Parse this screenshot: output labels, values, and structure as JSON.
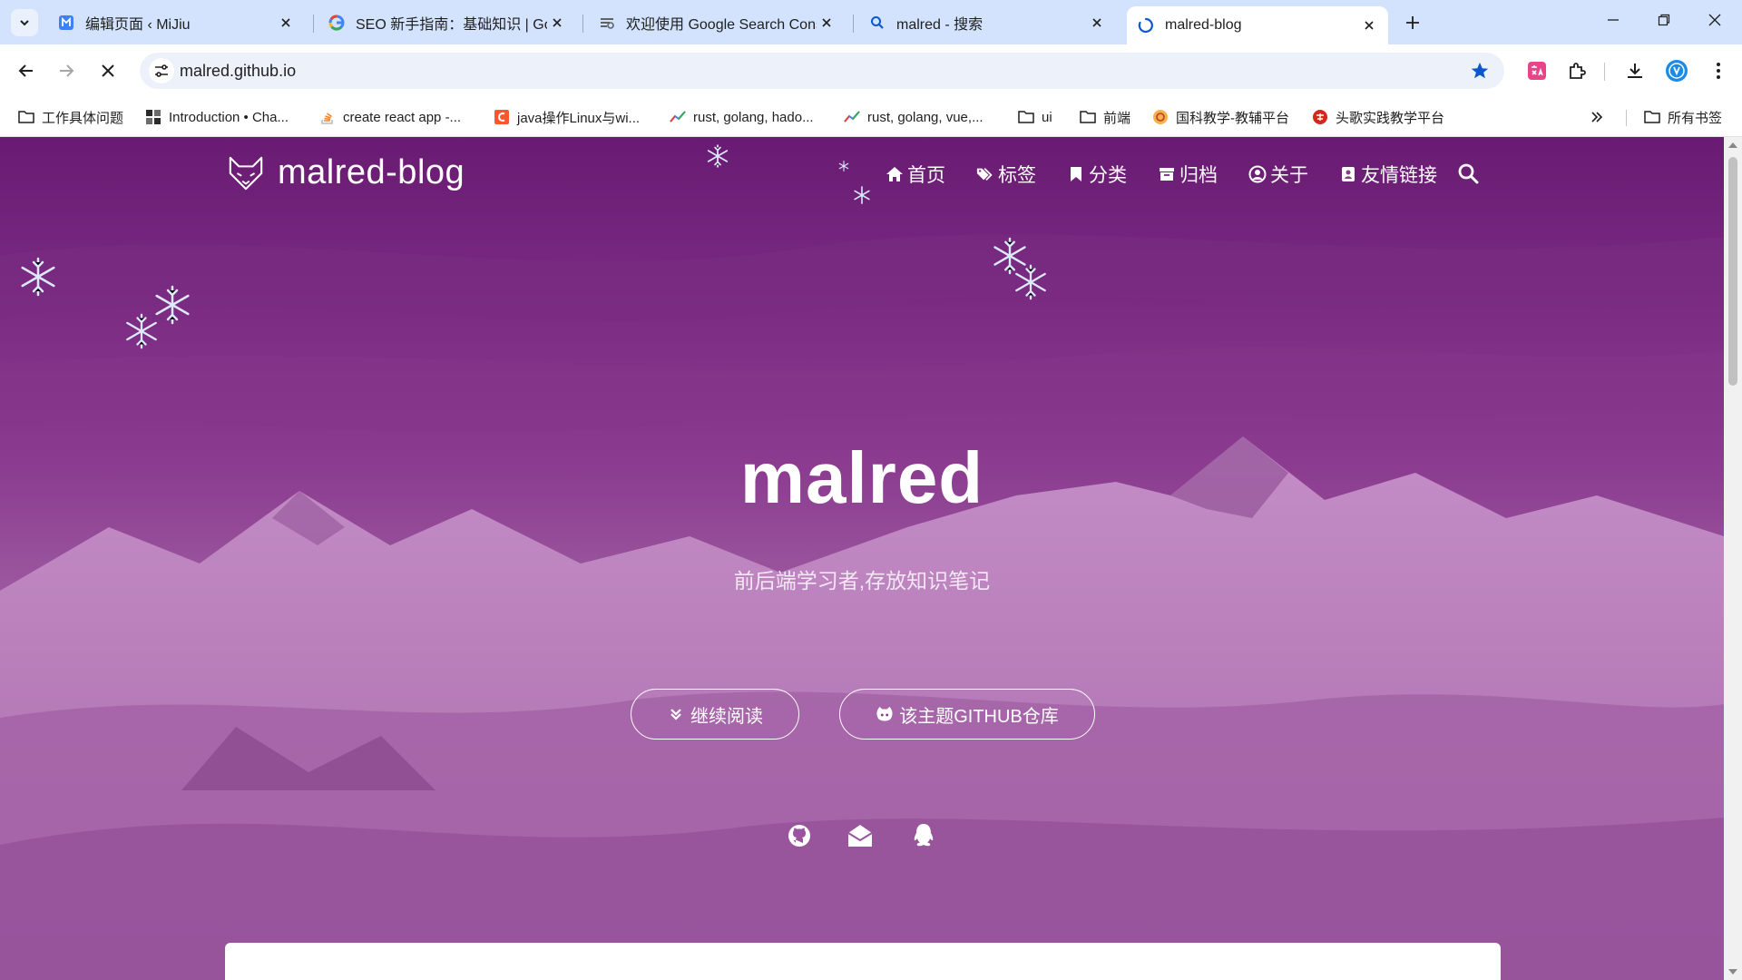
{
  "browser": {
    "tabs": [
      {
        "title": "编辑页面 ‹ MiJiu",
        "favicon": "mijiu-icon",
        "active": false
      },
      {
        "title": "SEO 新手指南：基础知识 | Goo",
        "favicon": "google-icon",
        "active": false
      },
      {
        "title": "欢迎使用 Google Search Cons",
        "favicon": "search-console-icon",
        "active": false
      },
      {
        "title": "malred - 搜索",
        "favicon": "search-icon",
        "active": false
      },
      {
        "title": "malred-blog",
        "favicon": "loading-icon",
        "active": true
      }
    ],
    "url": "malred.github.io",
    "bookmarks": [
      {
        "label": "工作具体问题",
        "icon": "folder-icon"
      },
      {
        "label": "Introduction • Cha...",
        "icon": "chakra-icon"
      },
      {
        "label": "create react app -...",
        "icon": "stackoverflow-icon"
      },
      {
        "label": "java操作Linux与wi...",
        "icon": "csdn-icon"
      },
      {
        "label": "rust, golang, hado...",
        "icon": "trends-icon"
      },
      {
        "label": "rust, golang, vue,...",
        "icon": "trends-icon"
      },
      {
        "label": "ui",
        "icon": "folder-icon"
      },
      {
        "label": "前端",
        "icon": "folder-icon"
      },
      {
        "label": "国科教学-教辅平台",
        "icon": "edu-icon"
      },
      {
        "label": "头歌实践教学平台",
        "icon": "touge-icon"
      }
    ],
    "all_bookmarks": "所有书签",
    "accent_color": "#0b57d0"
  },
  "site": {
    "brand": "malred-blog",
    "nav": [
      {
        "label": "首页",
        "icon": "home-icon"
      },
      {
        "label": "标签",
        "icon": "tags-icon"
      },
      {
        "label": "分类",
        "icon": "bookmark-icon"
      },
      {
        "label": "归档",
        "icon": "archive-icon"
      },
      {
        "label": "关于",
        "icon": "user-circle-icon"
      },
      {
        "label": "友情链接",
        "icon": "address-book-icon"
      }
    ],
    "hero_title": "malred",
    "hero_subtitle": "前后端学习者,存放知识笔记",
    "buttons": [
      {
        "label": "继续阅读",
        "icon": "double-chevron-down-icon"
      },
      {
        "label": "该主题GITHUB仓库",
        "icon": "github-alt-icon"
      }
    ],
    "social": [
      "github-icon",
      "email-icon",
      "qq-icon"
    ],
    "hero_color": "#8c3d90"
  }
}
